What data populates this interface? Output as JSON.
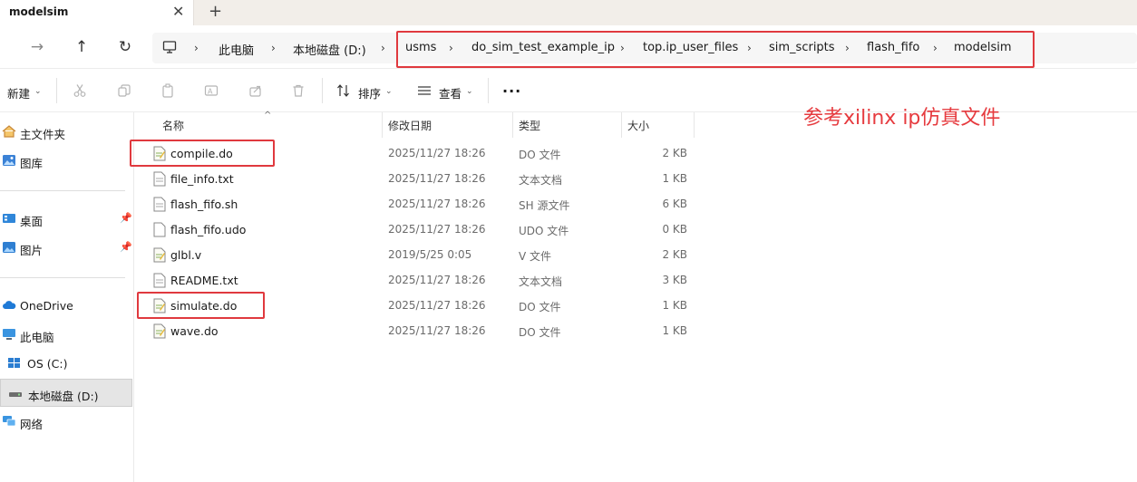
{
  "tab": {
    "title": "modelsim",
    "close": "✕",
    "new": "+"
  },
  "nav": {
    "forward": "→",
    "up": "↑",
    "refresh": "↻"
  },
  "breadcrumb": [
    "此电脑",
    "本地磁盘 (D:)",
    "usms",
    "do_sim_test_example_ip",
    "top.ip_user_files",
    "sim_scripts",
    "flash_fifo",
    "modelsim"
  ],
  "toolbar": {
    "new_label": "新建",
    "sort_label": "排序",
    "view_label": "查看",
    "more_label": "..."
  },
  "sidebar": {
    "home": "主文件夹",
    "gallery": "图库",
    "desktop": "桌面",
    "pictures": "图片",
    "onedrive": "OneDrive",
    "this_pc": "此电脑",
    "os_c": "OS (C:)",
    "local_d": "本地磁盘 (D:)",
    "network": "网络"
  },
  "columns": {
    "name": "名称",
    "modified": "修改日期",
    "type": "类型",
    "size": "大小"
  },
  "files": [
    {
      "name": "compile.do",
      "date": "2025/11/27 18:26",
      "type": "DO 文件",
      "size": "2 KB",
      "icon": "script-file-icon"
    },
    {
      "name": "file_info.txt",
      "date": "2025/11/27 18:26",
      "type": "文本文档",
      "size": "1 KB",
      "icon": "text-file-icon"
    },
    {
      "name": "flash_fifo.sh",
      "date": "2025/11/27 18:26",
      "type": "SH 源文件",
      "size": "6 KB",
      "icon": "text-file-icon"
    },
    {
      "name": "flash_fifo.udo",
      "date": "2025/11/27 18:26",
      "type": "UDO 文件",
      "size": "0 KB",
      "icon": "blank-file-icon"
    },
    {
      "name": "glbl.v",
      "date": "2019/5/25 0:05",
      "type": "V 文件",
      "size": "2 KB",
      "icon": "script-file-icon"
    },
    {
      "name": "README.txt",
      "date": "2025/11/27 18:26",
      "type": "文本文档",
      "size": "3 KB",
      "icon": "text-file-icon"
    },
    {
      "name": "simulate.do",
      "date": "2025/11/27 18:26",
      "type": "DO 文件",
      "size": "1 KB",
      "icon": "script-file-icon"
    },
    {
      "name": "wave.do",
      "date": "2025/11/27 18:26",
      "type": "DO 文件",
      "size": "1 KB",
      "icon": "script-file-icon"
    }
  ],
  "annotation": "参考xilinx ip仿真文件",
  "colors": {
    "highlight_red": "#e0393e",
    "annotation_red": "#e63b3f",
    "selected_bg": "#e5e5e5"
  }
}
